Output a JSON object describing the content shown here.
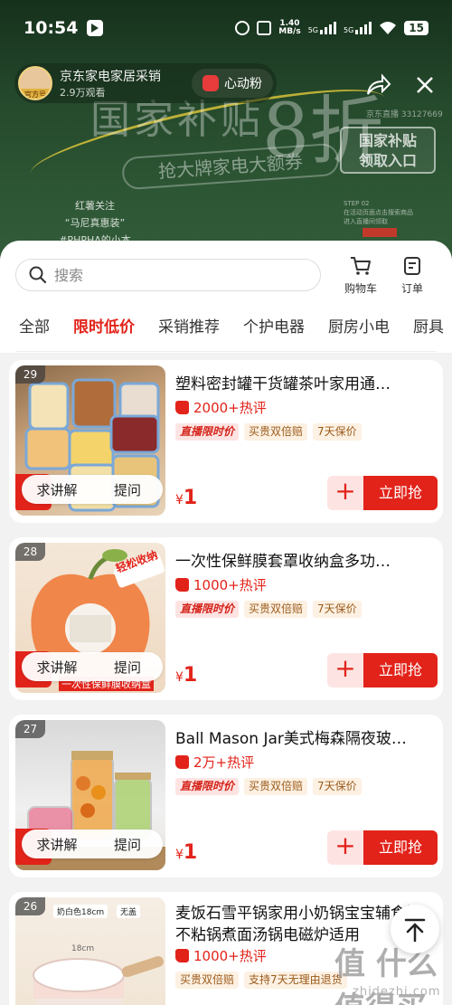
{
  "status_bar": {
    "time": "10:54",
    "net_speed_value": "1.40",
    "net_speed_unit": "MB/s",
    "sig1": "5G",
    "sig2": "5G",
    "battery": "15"
  },
  "live": {
    "host_name": "京东家电家居采销",
    "host_badge": "官方号",
    "views": "2.9万观看",
    "follow_label": "心动粉",
    "banner_title": "国家补贴",
    "banner_big": "8折",
    "banner_sub": "抢大牌家电大额券",
    "corner_text": "京东直播 33127669",
    "subsidy_box_line1": "国家补贴",
    "subsidy_box_line2": "领取入口",
    "notice_lines": [
      "红薯关注",
      "“马尼真惠装”",
      "#PHPHA的小本"
    ],
    "step_label": "STEP 02",
    "step_text": "在活动页面点击搜索商品进入直播间领取"
  },
  "sheet": {
    "search_placeholder": "搜索",
    "cart_label": "购物车",
    "order_label": "订单",
    "tabs": [
      "全部",
      "限时低价",
      "采销推荐",
      "个护电器",
      "厨房小电",
      "厨具"
    ],
    "active_tab": "限时低价"
  },
  "products": [
    {
      "rank": "29",
      "title": "塑料密封罐干货罐茶叶家用通…",
      "reviews": "2000+热评",
      "tags": [
        "直播限时价",
        "买贵双倍赔",
        "7天保价"
      ],
      "price_symbol": "¥",
      "price": "1",
      "ask_label": "求讲解",
      "question_label": "提问",
      "buy_label": "立即抢"
    },
    {
      "rank": "28",
      "title": "一次性保鲜膜套罩收纳盒多功…",
      "reviews": "1000+热评",
      "tags": [
        "直播限时价",
        "买贵双倍赔",
        "7天保价"
      ],
      "price_symbol": "¥",
      "price": "1",
      "ask_label": "求讲解",
      "question_label": "提问",
      "buy_label": "立即抢",
      "image_text": "轻松收纳",
      "image_caption": "一次性保鲜膜收纳盒"
    },
    {
      "rank": "27",
      "title": "Ball Mason Jar美式梅森隔夜玻…",
      "reviews": "2万+热评",
      "tags": [
        "直播限时价",
        "买贵双倍赔",
        "7天保价"
      ],
      "price_symbol": "¥",
      "price": "1",
      "ask_label": "求讲解",
      "question_label": "提问",
      "buy_label": "立即抢"
    },
    {
      "rank": "26",
      "title": "麦饭石雪平锅家用小奶锅宝宝辅食锅不粘锅煮面汤锅电磁炉适用",
      "reviews": "1000+热评",
      "tags": [
        "买贵双倍赔",
        "支持7天无理由退货"
      ],
      "image_text": "奶白色18cm",
      "image_tag2": "无盖",
      "size_label": "18cm"
    }
  ],
  "watermark": "值 什么值得买",
  "watermark_sub": "zhidezhi.com",
  "colors": {
    "accent_red": "#e2231a",
    "live_bg": "#24482b",
    "sheet_bg": "#f2f2f2"
  }
}
